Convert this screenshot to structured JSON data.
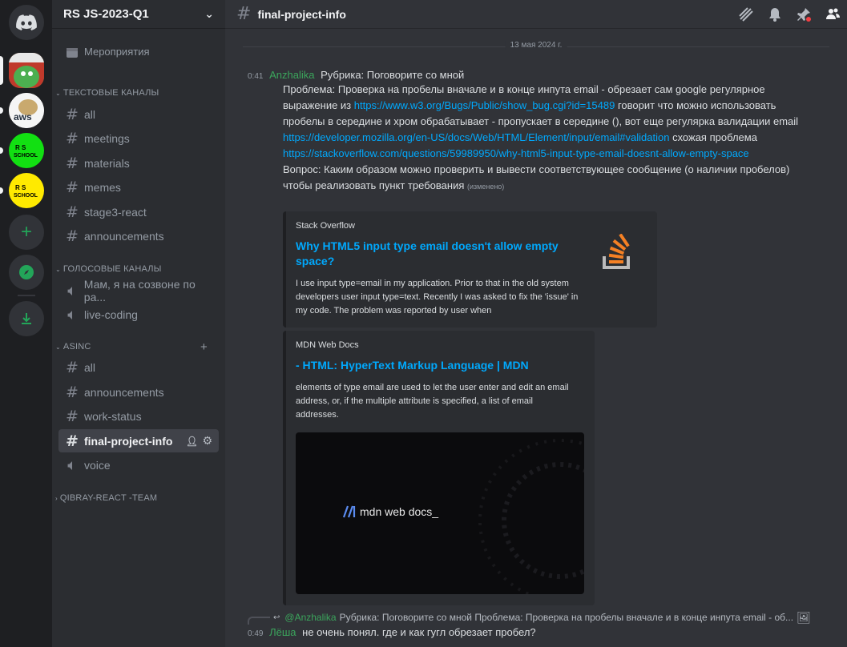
{
  "server": {
    "name": "RS JS-2023-Q1"
  },
  "sidebar": {
    "events_label": "Мероприятия",
    "categories": {
      "text": "ТЕКСТОВЫЕ КАНАЛЫ",
      "voice": "ГОЛОСОВЫЕ КАНАЛЫ",
      "asinc": "ASINC",
      "team": "QIBRAY-REACT -TEAM"
    },
    "text_channels": [
      "all",
      "meetings",
      "materials",
      "memes",
      "stage3-react",
      "announcements"
    ],
    "voice_channels": [
      "Мам, я на созвоне по ра...",
      "live-coding"
    ],
    "asinc_channels": [
      "all",
      "announcements",
      "work-status",
      "final-project-info",
      "voice"
    ]
  },
  "channel": {
    "title": "final-project-info"
  },
  "date_separator": "13 мая 2024 г.",
  "message1": {
    "time": "0:41",
    "author": "Anzhalika",
    "first_line": "Рубрика: Поговорите со мной",
    "p1": "Проблема: Проверка на пробелы вначале и в конце инпута email - обрезает сам google регулярное выражение из ",
    "link1": "https://www.w3.org/Bugs/Public/show_bug.cgi?id=15489",
    "p2": " говорит что можно использовать пробелы в середине и хром обрабатывает - пропускает в середине (), вот еще регулярка валидации email ",
    "link2": "https://developer.mozilla.org/en-US/docs/Web/HTML/Element/input/email#validation",
    "p3": " схожая проблема ",
    "link3": "https://stackoverflow.com/questions/59989950/why-html5-input-type-email-doesnt-allow-empty-space",
    "p4": "Вопрос: Каким образом можно проверить и вывести соответствующее сообщение (о наличии пробелов) чтобы реализовать пункт требования",
    "edited": "(изменено)"
  },
  "embed1": {
    "provider": "Stack Overflow",
    "title": "Why HTML5 input type email doesn't allow empty space?",
    "description": "I use input type=email in my application. Prior to that in the old system developers user input type=text. Recently I was asked to fix the 'issue' in my code. The problem was reported by user when"
  },
  "embed2": {
    "provider": "MDN Web Docs",
    "title": "- HTML: HyperText Markup Language | MDN",
    "description": "elements of type email are used to let the user enter and edit an email address, or, if the multiple attribute is specified, a list of email addresses.",
    "image_text": "mdn web docs_"
  },
  "reply": {
    "author": "@Anzhalika",
    "preview": "Рубрика: Поговорите со мной Проблема: Проверка на пробелы вначале и в конце инпута email - об..."
  },
  "message2": {
    "time": "0:49",
    "author": "Лёша",
    "text": "не очень понял. где и как гугл обрезает пробел?"
  },
  "colors": {
    "accent_link": "#00a8fc",
    "author_green": "#3ba55c",
    "background": "#313338"
  }
}
